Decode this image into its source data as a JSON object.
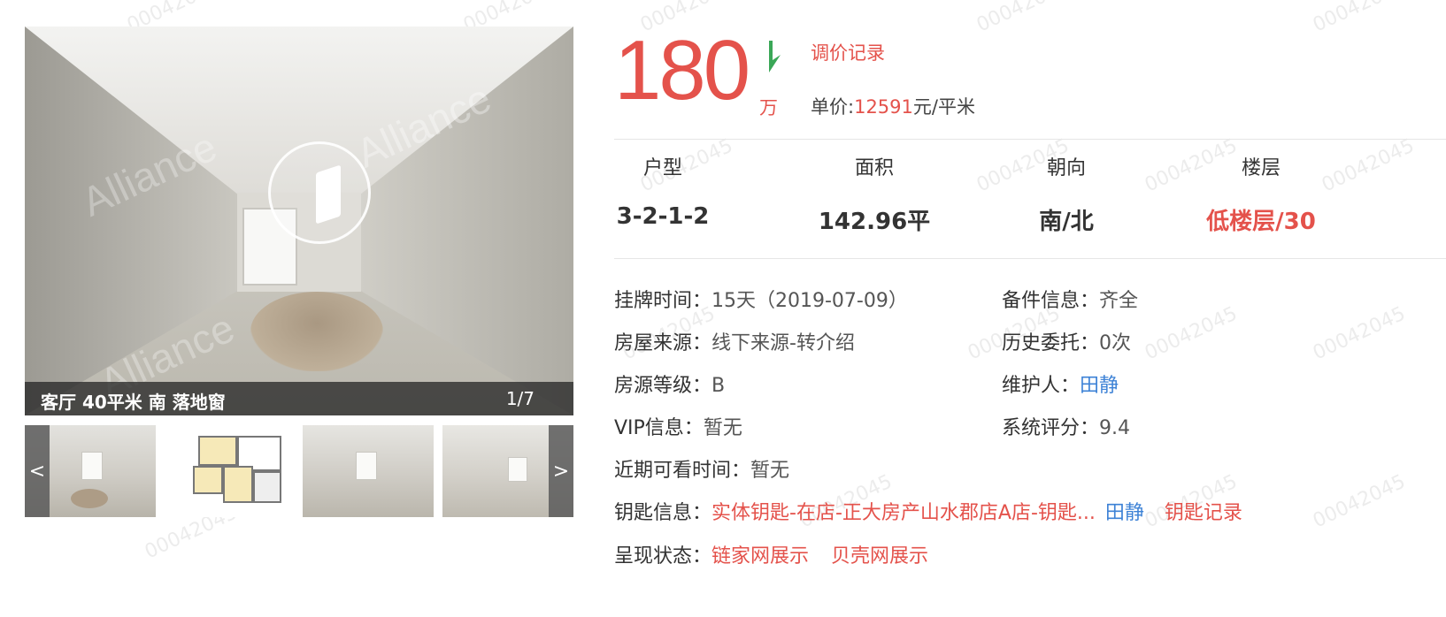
{
  "gallery": {
    "caption": "客厅 40平米 南 落地窗",
    "counter": "1/7",
    "prev_label": "<",
    "next_label": ">",
    "watermark": "Alliance"
  },
  "watermark_text": "00042045",
  "price": {
    "total": "180",
    "unit": "万",
    "trend_icon": "down-arrow-icon",
    "adjust_link": "调价记录",
    "unit_price_label": "单价:",
    "unit_price_value": "12591",
    "unit_price_suffix": "元/平米"
  },
  "specs": [
    {
      "label": "户型",
      "value": "3-2-1-2"
    },
    {
      "label": "面积",
      "value": "142.96平"
    },
    {
      "label": "朝向",
      "value": "南/北"
    },
    {
      "label": "楼层",
      "value": "低楼层/30"
    }
  ],
  "details": {
    "listing_time_label": "挂牌时间：",
    "listing_time_value": "15天（2019-07-09）",
    "backup_label": "备件信息：",
    "backup_value": "齐全",
    "source_label": "房屋来源：",
    "source_value": "线下来源-转介绍",
    "history_label": "历史委托：",
    "history_value": "0次",
    "grade_label": "房源等级：",
    "grade_value": "B",
    "maintainer_label": "维护人：",
    "maintainer_value": "田静",
    "vip_label": "VIP信息：",
    "vip_value": "暂无",
    "score_label": "系统评分：",
    "score_value": "9.4",
    "viewing_label": "近期可看时间：",
    "viewing_value": "暂无",
    "key_label": "钥匙信息：",
    "key_value": "实体钥匙-在店-正大房产山水郡店A店-钥匙...",
    "key_person": "田静",
    "key_record": "钥匙记录",
    "display_label": "呈现状态：",
    "display_lianjia": "链家网展示",
    "display_beike": "贝壳网展示"
  },
  "colors": {
    "accent_red": "#e4524b",
    "link_blue": "#3d82d6",
    "trend_green": "#3aa757"
  }
}
